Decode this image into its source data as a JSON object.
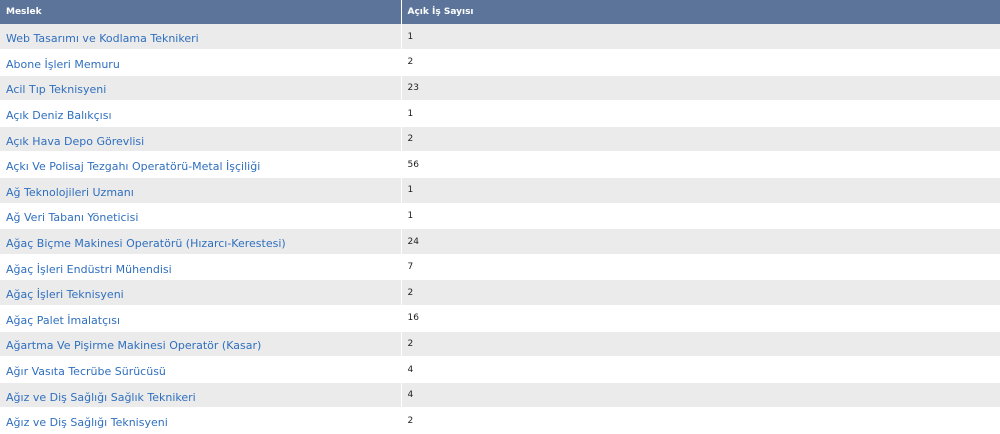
{
  "table": {
    "headers": [
      "Meslek",
      "Açık İş Sayısı"
    ],
    "rows": [
      {
        "meslek": "Web Tasarımı ve Kodlama Teknikeri",
        "sayi": "1"
      },
      {
        "meslek": "Abone İşleri Memuru",
        "sayi": "2"
      },
      {
        "meslek": "Acil Tıp Teknisyeni",
        "sayi": "23"
      },
      {
        "meslek": "Açık Deniz Balıkçısı",
        "sayi": "1"
      },
      {
        "meslek": "Açık Hava Depo Görevlisi",
        "sayi": "2"
      },
      {
        "meslek": "Açkı Ve Polisaj Tezgahı Operatörü-Metal İşçiliği",
        "sayi": "56"
      },
      {
        "meslek": "Ağ Teknolojileri Uzmanı",
        "sayi": "1"
      },
      {
        "meslek": "Ağ Veri Tabanı Yöneticisi",
        "sayi": "1"
      },
      {
        "meslek": "Ağaç Biçme Makinesi Operatörü (Hızarcı-Kerestesi)",
        "sayi": "24"
      },
      {
        "meslek": "Ağaç İşleri Endüstri Mühendisi",
        "sayi": "7"
      },
      {
        "meslek": "Ağaç İşleri Teknisyeni",
        "sayi": "2"
      },
      {
        "meslek": "Ağaç Palet İmalatçısı",
        "sayi": "16"
      },
      {
        "meslek": "Ağartma Ve Pişirme Makinesi Operatör (Kasar)",
        "sayi": "2"
      },
      {
        "meslek": "Ağır Vasıta Tecrübe Sürücüsü",
        "sayi": "4"
      },
      {
        "meslek": "Ağız ve Diş Sağlığı Sağlık Teknikeri",
        "sayi": "4"
      },
      {
        "meslek": "Ağız ve Diş Sağlığı Teknisyeni",
        "sayi": "2"
      }
    ]
  },
  "colors": {
    "header_bg": "#5c7499",
    "link": "#2f6fbf",
    "row_alt": "#ebebeb"
  }
}
